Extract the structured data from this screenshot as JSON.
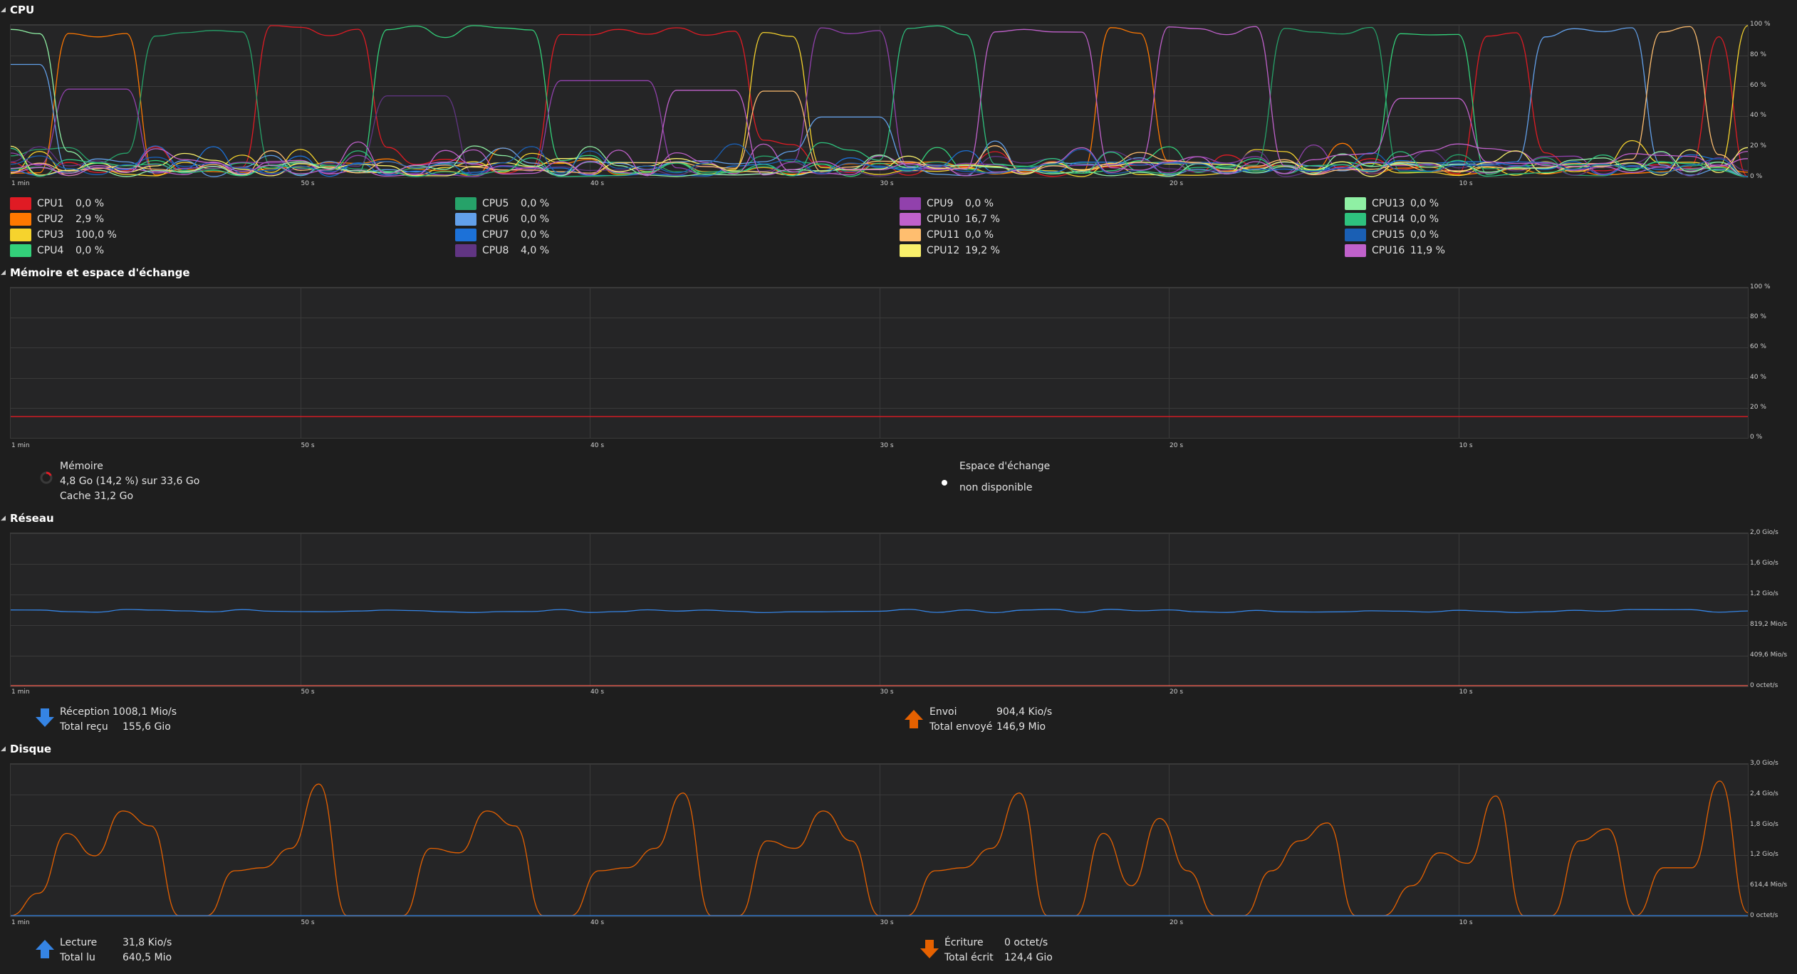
{
  "x_ticks": [
    "1 min",
    "50 s",
    "40 s",
    "30 s",
    "20 s",
    "10 s"
  ],
  "cpu": {
    "title": "CPU",
    "y_ticks": [
      "100 %",
      "80 %",
      "60 %",
      "40 %",
      "20 %",
      "0 %"
    ],
    "items": [
      {
        "name": "CPU1",
        "value": "0,0 %",
        "color": "#e01b24"
      },
      {
        "name": "CPU2",
        "value": "2,9 %",
        "color": "#ff7800"
      },
      {
        "name": "CPU3",
        "value": "100,0 %",
        "color": "#f6d32d"
      },
      {
        "name": "CPU4",
        "value": "0,0 %",
        "color": "#33d17a"
      },
      {
        "name": "CPU5",
        "value": "0,0 %",
        "color": "#26a269"
      },
      {
        "name": "CPU6",
        "value": "0,0 %",
        "color": "#62a0ea"
      },
      {
        "name": "CPU7",
        "value": "0,0 %",
        "color": "#1c71d8"
      },
      {
        "name": "CPU8",
        "value": "4,0 %",
        "color": "#613583"
      },
      {
        "name": "CPU9",
        "value": "0,0 %",
        "color": "#9141ac"
      },
      {
        "name": "CPU10",
        "value": "16,7 %",
        "color": "#c061cb"
      },
      {
        "name": "CPU11",
        "value": "0,0 %",
        "color": "#ffbe6f"
      },
      {
        "name": "CPU12",
        "value": "19,2 %",
        "color": "#f9f06b"
      },
      {
        "name": "CPU13",
        "value": "0,0 %",
        "color": "#8ff0a4"
      },
      {
        "name": "CPU14",
        "value": "0,0 %",
        "color": "#2ec27e"
      },
      {
        "name": "CPU15",
        "value": "0,0 %",
        "color": "#1a5fb4"
      },
      {
        "name": "CPU16",
        "value": "11,9 %",
        "color": "#c061cb"
      }
    ]
  },
  "memory": {
    "title": "Mémoire et espace d'échange",
    "y_ticks": [
      "100 %",
      "80 %",
      "60 %",
      "40 %",
      "20 %",
      "0 %"
    ],
    "mem_label": "Mémoire",
    "mem_usage": "4,8 Go (14,2 %) sur 33,6 Go",
    "mem_cache": "Cache 31,2 Go",
    "mem_percent": 14.2,
    "mem_color": "#e01b24",
    "swap_label": "Espace d'échange",
    "swap_status": "non disponible"
  },
  "network": {
    "title": "Réseau",
    "y_ticks": [
      "2,0 Gio/s",
      "1,6 Gio/s",
      "1,2 Gio/s",
      "819,2 Mio/s",
      "409,6 Mio/s",
      "0 octet/s"
    ],
    "recv_label": "Réception",
    "recv_rate": "1008,1 Mio/s",
    "recv_total_label": "Total reçu",
    "recv_total": "155,6 Gio",
    "recv_color": "#3584e4",
    "send_label": "Envoi",
    "send_rate": "904,4 Kio/s",
    "send_total_label": "Total envoyé",
    "send_total": "146,9 Mio",
    "send_color": "#f66151"
  },
  "disk": {
    "title": "Disque",
    "y_ticks": [
      "3,0 Gio/s",
      "2,4 Gio/s",
      "1,8 Gio/s",
      "1,2 Gio/s",
      "614,4 Mio/s",
      "0 octet/s"
    ],
    "read_label": "Lecture",
    "read_rate": "31,8 Kio/s",
    "read_total_label": "Total lu",
    "read_total": "640,5 Mio",
    "read_color": "#3584e4",
    "write_label": "Écriture",
    "write_rate": "0 octet/s",
    "write_total_label": "Total écrit",
    "write_total": "124,4 Gio",
    "write_color": "#e66100"
  }
}
